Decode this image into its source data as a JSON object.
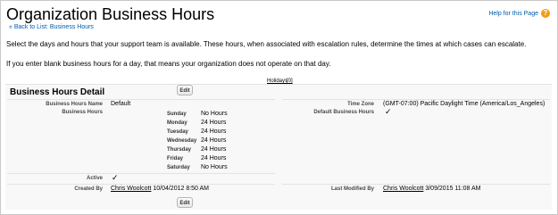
{
  "header": {
    "title": "Organization Business Hours",
    "back_link": "« Back to List: Business Hours",
    "help_link": "Help for this Page",
    "help_icon": "question-icon"
  },
  "intro": {
    "paragraph1": "Select the days and hours that your support team is available. These hours, when associated with escalation rules, determine the times at which cases can escalate.",
    "paragraph2": "If you enter blank business hours for a day, that means your organization does not operate on that day."
  },
  "holidays": {
    "label": "Holidays",
    "count": "[0]"
  },
  "detail": {
    "section_title": "Business Hours Detail",
    "edit_label": "Edit",
    "name_label": "Business Hours Name",
    "name_value": "Default",
    "hours_label": "Business Hours",
    "timezone_label": "Time Zone",
    "timezone_value": "(GMT-07:00) Pacific Daylight Time (America/Los_Angeles)",
    "default_label": "Default Business Hours",
    "default_check": "✓",
    "days": [
      {
        "day": "Sunday",
        "hours": "No Hours"
      },
      {
        "day": "Monday",
        "hours": "24 Hours"
      },
      {
        "day": "Tuesday",
        "hours": "24 Hours"
      },
      {
        "day": "Wednesday",
        "hours": "24 Hours"
      },
      {
        "day": "Thursday",
        "hours": "24 Hours"
      },
      {
        "day": "Friday",
        "hours": "24 Hours"
      },
      {
        "day": "Saturday",
        "hours": "No Hours"
      }
    ],
    "active_label": "Active",
    "active_check": "✓",
    "created_label": "Created By",
    "created_user": "Chris Woolcott",
    "created_date": "10/04/2012 8:50 AM",
    "modified_label": "Last Modified By",
    "modified_user": "Chris Woolcott",
    "modified_date": "3/09/2015 11:08 AM"
  }
}
